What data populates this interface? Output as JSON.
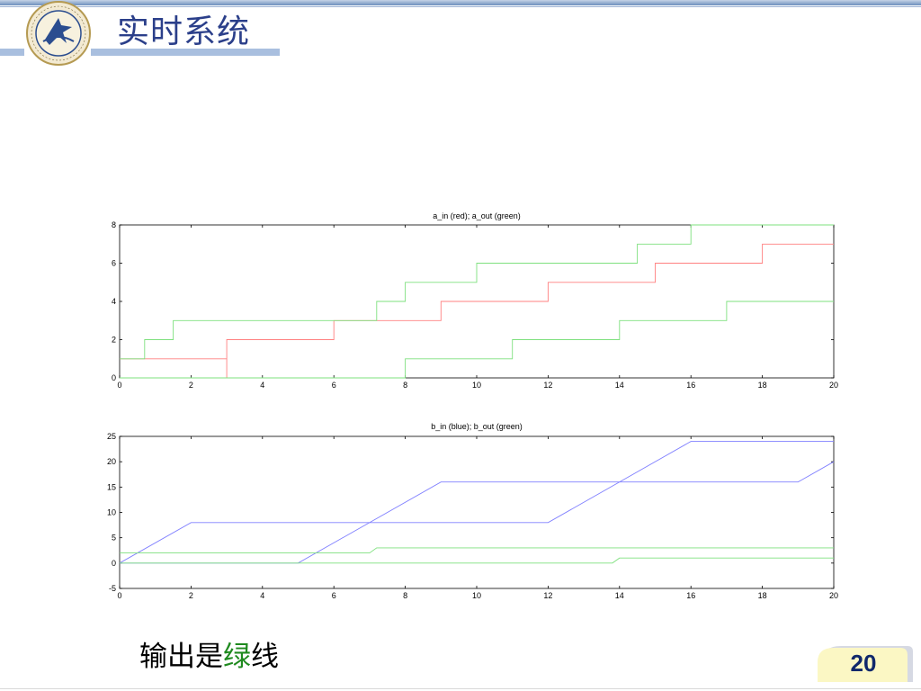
{
  "header": {
    "title": "实时系统"
  },
  "caption": {
    "prefix": "输出是",
    "highlight": "绿",
    "suffix": "线"
  },
  "page": {
    "number": "20"
  },
  "colors": {
    "title": "#2b3f8a",
    "red": "#ff8080",
    "green": "#7ee07e",
    "blue": "#8080ff",
    "highlight": "#1f8a1f",
    "badge_text": "#10286b"
  },
  "chart_data": [
    {
      "type": "line",
      "title": "a_in (red); a_out (green)",
      "xlim": [
        0,
        20
      ],
      "ylim": [
        0,
        8
      ],
      "xticks": [
        0,
        2,
        4,
        6,
        8,
        10,
        12,
        14,
        16,
        18,
        20
      ],
      "yticks": [
        0,
        2,
        4,
        6,
        8
      ],
      "series": [
        {
          "color": "red",
          "step": true,
          "points": [
            [
              0,
              1
            ],
            [
              3,
              1
            ],
            [
              3,
              0
            ],
            [
              3,
              2
            ],
            [
              6,
              2
            ],
            [
              6,
              3
            ],
            [
              9,
              3
            ],
            [
              9,
              4
            ],
            [
              12,
              4
            ],
            [
              12,
              5
            ],
            [
              15,
              5
            ],
            [
              15,
              6
            ],
            [
              18,
              6
            ],
            [
              18,
              7
            ],
            [
              20,
              7
            ]
          ]
        },
        {
          "color": "green",
          "step": true,
          "points": [
            [
              0,
              0
            ],
            [
              8,
              0
            ],
            [
              8,
              1
            ],
            [
              11,
              1
            ],
            [
              11,
              2
            ],
            [
              14,
              2
            ],
            [
              14,
              3
            ],
            [
              17,
              3
            ],
            [
              17,
              4
            ],
            [
              20,
              4
            ]
          ]
        },
        {
          "color": "green",
          "step": true,
          "points": [
            [
              0,
              1
            ],
            [
              0.7,
              1
            ],
            [
              0.7,
              2
            ],
            [
              1.5,
              2
            ],
            [
              1.5,
              3
            ],
            [
              7.2,
              3
            ],
            [
              7.2,
              4
            ],
            [
              8,
              4
            ],
            [
              8,
              5
            ],
            [
              10,
              5
            ],
            [
              10,
              6
            ],
            [
              14.5,
              6
            ],
            [
              14.5,
              7
            ],
            [
              16,
              7
            ],
            [
              16,
              8
            ],
            [
              20,
              8
            ]
          ]
        }
      ]
    },
    {
      "type": "line",
      "title": "b_in (blue); b_out (green)",
      "xlim": [
        0,
        20
      ],
      "ylim": [
        -5,
        25
      ],
      "xticks": [
        0,
        2,
        4,
        6,
        8,
        10,
        12,
        14,
        16,
        18,
        20
      ],
      "yticks": [
        -5,
        0,
        5,
        10,
        15,
        20,
        25
      ],
      "series": [
        {
          "color": "blue",
          "points": [
            [
              0,
              0
            ],
            [
              2,
              8
            ],
            [
              12,
              8
            ],
            [
              16,
              24
            ],
            [
              20,
              24
            ]
          ]
        },
        {
          "color": "blue",
          "points": [
            [
              0,
              0
            ],
            [
              5,
              0
            ],
            [
              9,
              16
            ],
            [
              19,
              16
            ],
            [
              20,
              20
            ]
          ]
        },
        {
          "color": "green",
          "points": [
            [
              0,
              2
            ],
            [
              7,
              2
            ],
            [
              7.2,
              3
            ],
            [
              20,
              3
            ]
          ]
        },
        {
          "color": "green",
          "points": [
            [
              0,
              0
            ],
            [
              13.8,
              0
            ],
            [
              14,
              1
            ],
            [
              20,
              1
            ]
          ]
        }
      ]
    }
  ]
}
